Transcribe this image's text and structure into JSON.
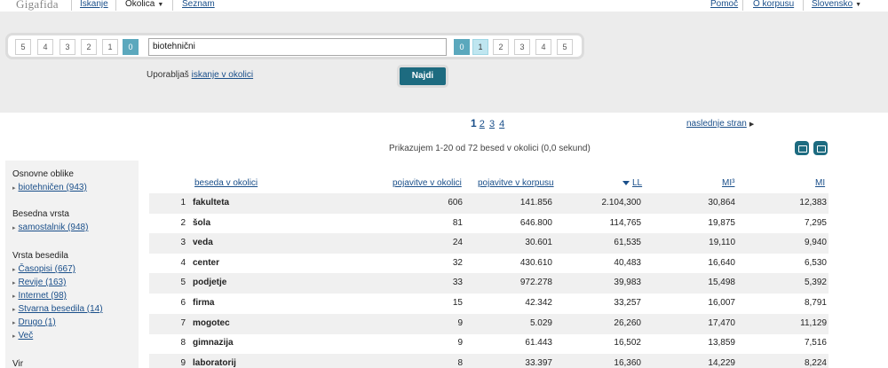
{
  "nav": {
    "logo": "Gigafida",
    "search": "Iskanje",
    "okolica": "Okolica",
    "seznam": "Seznam",
    "help": "Pomoč",
    "about": "O korpusu",
    "language": "Slovensko"
  },
  "search": {
    "left_pills": [
      "5",
      "4",
      "3",
      "2",
      "1",
      "0"
    ],
    "right_pills": [
      "0",
      "1",
      "2",
      "3",
      "4",
      "5"
    ],
    "query": "biotehnični",
    "hint_prefix": "Uporabljaš",
    "hint_link": "iskanje v okolici",
    "button": "Najdi"
  },
  "pagination": {
    "current": "1",
    "pages": [
      "2",
      "3",
      "4"
    ],
    "last": "naslednje stran"
  },
  "summary": "Prikazujem 1-20 od 72 besed v okolici (0,0 sekund)",
  "sidebar": {
    "sections": [
      {
        "title": "Osnovne oblike",
        "items": [
          "biotehničen (943)"
        ]
      },
      {
        "title": "Besedna vrsta",
        "items": [
          "samostalnik (948)"
        ]
      },
      {
        "title": "Vrsta besedila",
        "items": [
          "Časopisi (667)",
          "Revije (163)",
          "Internet (98)",
          "Stvarna besedila (14)",
          "Drugo (1)",
          "Več"
        ]
      },
      {
        "title": "Vir",
        "items": []
      }
    ]
  },
  "table": {
    "headers": {
      "word": "beseda v okolici",
      "freq_context": "pojavitve v okolici",
      "freq_corpus": "pojavitve v korpusu",
      "ll": "LL",
      "mi3": "MI³",
      "mi": "MI"
    },
    "rows": [
      {
        "idx": "1",
        "word": "fakulteta",
        "fc": "606",
        "fk": "141.856",
        "ll": "2.104,300",
        "mi3": "30,864",
        "mi": "12,383"
      },
      {
        "idx": "2",
        "word": "šola",
        "fc": "81",
        "fk": "646.800",
        "ll": "114,765",
        "mi3": "19,875",
        "mi": "7,295"
      },
      {
        "idx": "3",
        "word": "veda",
        "fc": "24",
        "fk": "30.601",
        "ll": "61,535",
        "mi3": "19,110",
        "mi": "9,940"
      },
      {
        "idx": "4",
        "word": "center",
        "fc": "32",
        "fk": "430.610",
        "ll": "40,483",
        "mi3": "16,640",
        "mi": "6,530"
      },
      {
        "idx": "5",
        "word": "podjetje",
        "fc": "33",
        "fk": "972.278",
        "ll": "39,983",
        "mi3": "15,498",
        "mi": "5,392"
      },
      {
        "idx": "6",
        "word": "firma",
        "fc": "15",
        "fk": "42.342",
        "ll": "33,257",
        "mi3": "16,007",
        "mi": "8,791"
      },
      {
        "idx": "7",
        "word": "mogotec",
        "fc": "9",
        "fk": "5.029",
        "ll": "26,260",
        "mi3": "17,470",
        "mi": "11,129"
      },
      {
        "idx": "8",
        "word": "gimnazija",
        "fc": "9",
        "fk": "61.443",
        "ll": "16,502",
        "mi3": "13,859",
        "mi": "7,516"
      },
      {
        "idx": "9",
        "word": "laboratorij",
        "fc": "8",
        "fk": "33.397",
        "ll": "16,360",
        "mi3": "14,229",
        "mi": "8,224"
      }
    ]
  }
}
